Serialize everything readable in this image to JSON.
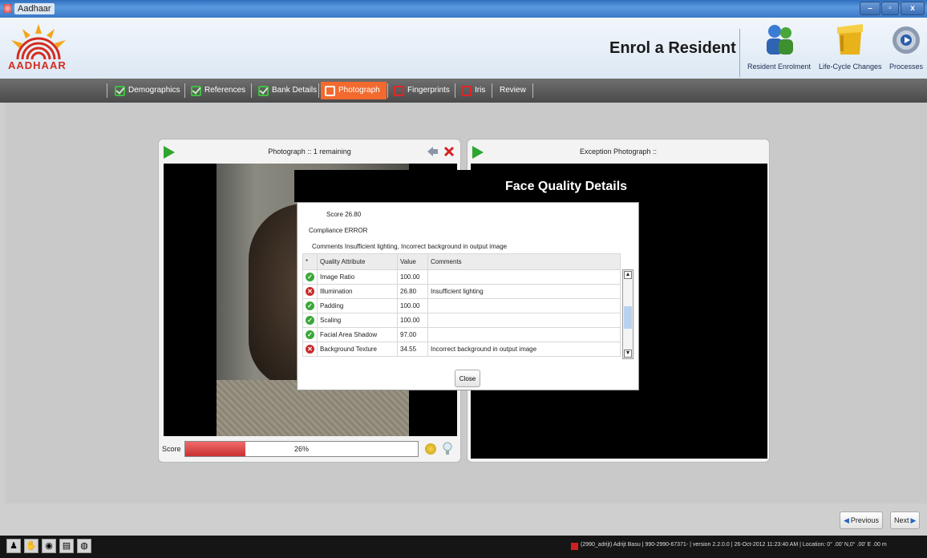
{
  "window": {
    "title": "Aadhaar",
    "minimize": "–",
    "restore": "▫",
    "close": "x"
  },
  "header": {
    "logo_text": "AADHAAR",
    "page_title": "Enrol a Resident",
    "buttons": [
      {
        "label": "Resident Enrolment",
        "icon": "people-icon"
      },
      {
        "label": "Life-Cycle Changes",
        "icon": "box-icon"
      },
      {
        "label": "Processes",
        "icon": "gear-icon"
      }
    ]
  },
  "tabs": [
    {
      "label": "Demographics",
      "state": "complete"
    },
    {
      "label": "References",
      "state": "complete"
    },
    {
      "label": "Bank Details",
      "state": "complete"
    },
    {
      "label": "Photograph",
      "state": "active"
    },
    {
      "label": "Fingerprints",
      "state": "incomplete"
    },
    {
      "label": "Iris",
      "state": "incomplete"
    },
    {
      "label": "Review",
      "state": "none"
    }
  ],
  "photo_panel": {
    "title": "Photograph :: 1 remaining",
    "score_label": "Score",
    "score_text": "26%",
    "score_value": 0.26
  },
  "exception_panel": {
    "title": "Exception Photograph ::"
  },
  "dialog": {
    "title": "Face Quality Details",
    "score_line": "Score 26.80",
    "compliance_line": "Compliance ERROR",
    "comments_line": "Comments Insufficient lighting, Incorrect background in output image",
    "columns": [
      "*",
      "Quality Attribute",
      "Value",
      "Comments"
    ],
    "rows": [
      {
        "status": "ok",
        "attribute": "Image Ratio",
        "value": "100.00",
        "comment": ""
      },
      {
        "status": "error",
        "attribute": "Illumination",
        "value": "26.80",
        "comment": "Insufficient lighting"
      },
      {
        "status": "ok",
        "attribute": "Padding",
        "value": "100.00",
        "comment": ""
      },
      {
        "status": "ok",
        "attribute": "Scaling",
        "value": "100.00",
        "comment": ""
      },
      {
        "status": "ok",
        "attribute": "Facial Area Shadow",
        "value": "97.00",
        "comment": ""
      },
      {
        "status": "error",
        "attribute": "Background Texture",
        "value": "34.55",
        "comment": "Incorrect background in output image"
      }
    ],
    "close_label": "Close"
  },
  "nav": {
    "previous": "Previous",
    "next": "Next"
  },
  "status": {
    "operator": "(2990_adrijt) Adrijt Basu",
    "station": "990-2990-67371-",
    "version": "version 2.2.0.0",
    "datetime": "26-Oct-2012 11:23:40 AM",
    "location": "Location: 0° .00' N,0° .00' E .00 m"
  },
  "colors": {
    "accent": "#f26a2e",
    "ok": "#3aa83a",
    "error": "#c92b2b"
  }
}
